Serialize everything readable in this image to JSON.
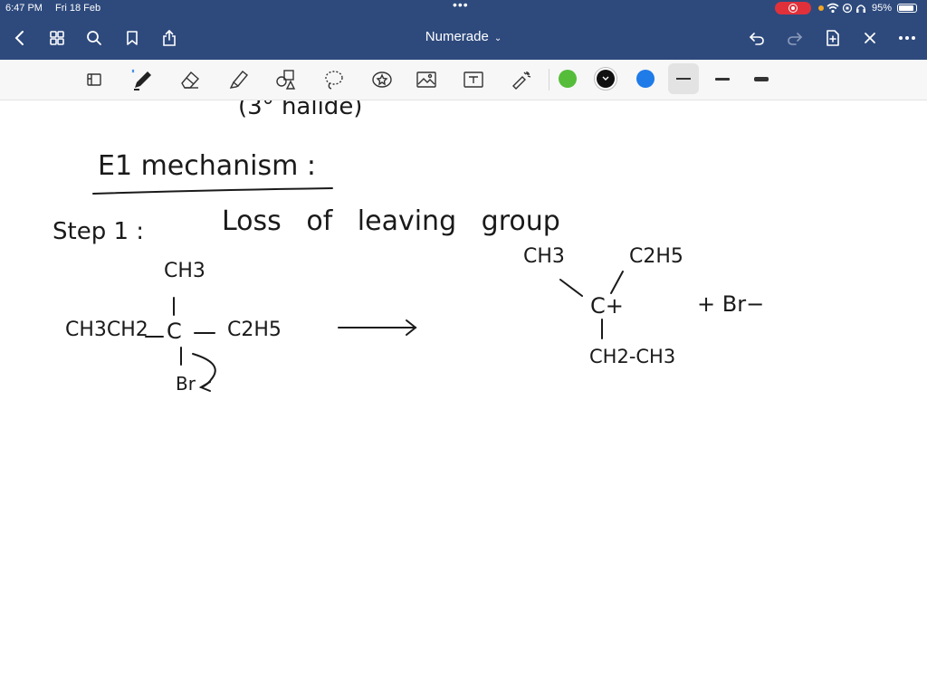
{
  "status_bar": {
    "time": "6:47 PM",
    "date": "Fri 18 Feb",
    "battery": "95%",
    "battery_level": 0.95
  },
  "nav": {
    "title": "Numerade",
    "icons": [
      "back-icon",
      "grid-icon",
      "search-icon",
      "bookmark-icon",
      "share-icon",
      "undo-icon",
      "redo-icon",
      "add-page-icon",
      "close-icon",
      "more-icon"
    ]
  },
  "toolbar": {
    "tools": [
      "read-mode-icon",
      "pen-icon",
      "eraser-icon",
      "highlighter-icon",
      "shapes-icon",
      "lasso-icon",
      "sticker-icon",
      "image-icon",
      "text-icon",
      "laser-pointer-icon"
    ],
    "colors": [
      "#55bd3a",
      "#111111",
      "#1f7be8"
    ],
    "selected_color": "#111111"
  },
  "note": {
    "top_partial": "(3° halide)",
    "heading": "E1 mechanism :",
    "step_label": "Step 1 :",
    "step_text": "Loss of leaving group",
    "reactant": {
      "top": "CH3",
      "left": "CH3CH2",
      "center": "C",
      "right": "C2H5",
      "bottom": "Br"
    },
    "product": {
      "upper_left": "CH3",
      "upper_right": "C2H5",
      "center": "C+",
      "bottom": "CH2-CH3",
      "byproduct": "+ Br−"
    }
  }
}
